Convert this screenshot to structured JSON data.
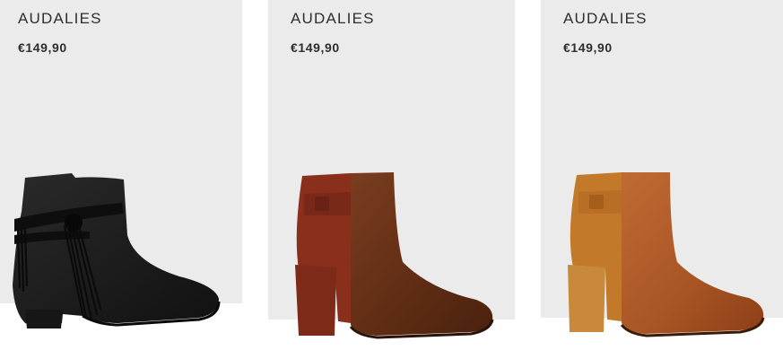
{
  "products": [
    {
      "brand": "AUDALIES",
      "price": "€149,90",
      "colorway": "black suede",
      "image": "boot-icon"
    },
    {
      "brand": "AUDALIES",
      "price": "€149,90",
      "colorway": "burgundy suede / brown leather",
      "image": "boot-icon"
    },
    {
      "brand": "AUDALIES",
      "price": "€149,90",
      "colorway": "tan suede / cognac leather",
      "image": "boot-icon"
    }
  ],
  "colors": {
    "panel_bg": "#ebebeb",
    "text": "#2e2e2e"
  }
}
